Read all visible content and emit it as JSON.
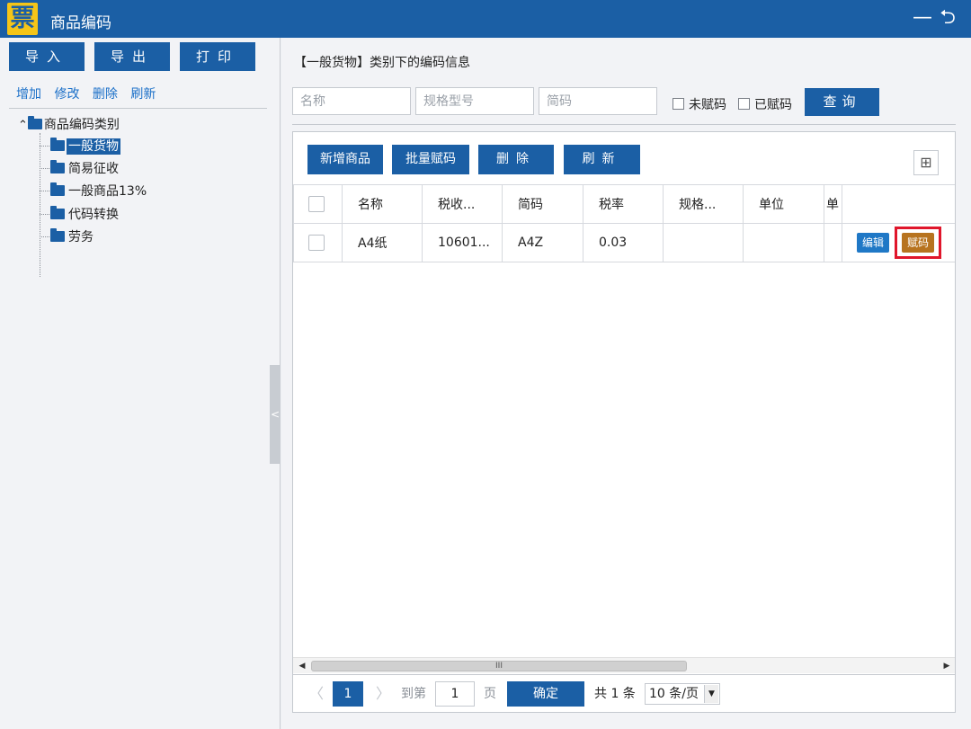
{
  "window": {
    "logo": "票",
    "title": "商品编码",
    "minimize": "—",
    "back": "⮌"
  },
  "left": {
    "toolbar": [
      "导入",
      "导出",
      "打印"
    ],
    "links": [
      "增加",
      "修改",
      "删除",
      "刷新"
    ],
    "tree": {
      "expander": "⌃",
      "root": "商品编码类别",
      "items": [
        "一般货物",
        "简易征收",
        "一般商品13%",
        "代码转换",
        "劳务"
      ],
      "selected_index": 0
    },
    "collapse_handle": "<"
  },
  "main": {
    "heading": "【一般货物】类别下的编码信息",
    "search": {
      "name_placeholder": "名称",
      "spec_placeholder": "规格型号",
      "short_placeholder": "简码",
      "unassigned_label": "未赋码",
      "assigned_label": "已赋码",
      "query_label": "查询"
    },
    "grid_toolbar": [
      "新增商品",
      "批量赋码",
      "删除",
      "刷新"
    ],
    "grid_icon": "⊞",
    "columns": [
      "名称",
      "税收...",
      "简码",
      "税率",
      "规格...",
      "单位",
      "单"
    ],
    "rows": [
      {
        "name": "A4纸",
        "tax_code": "10601...",
        "short_code": "A4Z",
        "rate": "0.03",
        "spec": "",
        "unit": "",
        "edit_label": "编辑",
        "assign_label": "赋码"
      }
    ],
    "scroll": {
      "left": "◀",
      "right": "▶",
      "grip": "III"
    },
    "pager": {
      "prev": "〈",
      "current": "1",
      "next": "〉",
      "goto_label": "到第",
      "goto_value": "1",
      "page_label": "页",
      "confirm_label": "确定",
      "total_text": "共 1 条",
      "page_size": "10 条/页",
      "dropdown": "▼"
    }
  }
}
